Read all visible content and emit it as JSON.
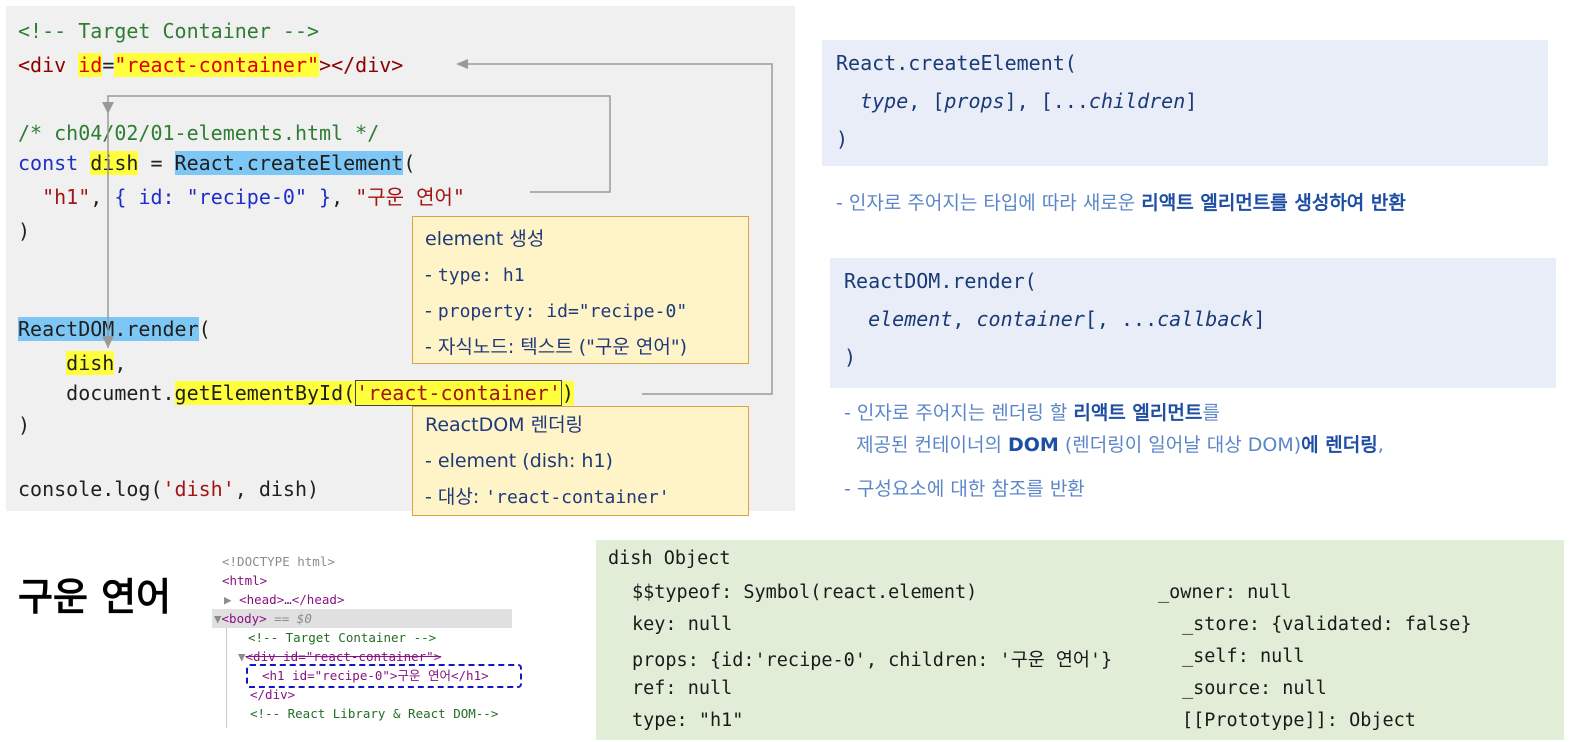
{
  "code": {
    "line1": "<!-- Target Container -->",
    "line2_open": "<div ",
    "line2_attr": "id",
    "line2_eq": "=",
    "line2_val": "\"react-container\"",
    "line2_close": "></div>",
    "line3": "/* ch04/02/01-elements.html */",
    "line4_const": "const ",
    "line4_var": "dish",
    "line4_eq": " = ",
    "line4_fn": "React.createElement",
    "line4_paren": "(",
    "line5_indent": "  ",
    "line5_type": "\"h1\"",
    "line5_comma": ", ",
    "line5_props": "{ id: \"recipe-0\" }",
    "line5_comma2": ", ",
    "line5_child": "\"구운 연어\"",
    "line6": ")",
    "line7_fn": "ReactDOM.render",
    "line7_paren": "(",
    "line8_indent": "    ",
    "line8_var": "dish",
    "line8_comma": ",",
    "line9_prefix": "    document.",
    "line9_fn": "getElementById(",
    "line9_arg": "'react-container'",
    "line9_close": ")",
    "line10": ")",
    "line11_prefix": "console.log(",
    "line11_str": "'dish'",
    "line11_suffix": ", dish)"
  },
  "note_element": {
    "title": "element 생성",
    "type_prefix": "- ",
    "type_value": "type: h1",
    "prop_prefix": "- ",
    "prop_value": "property: id=\"recipe-0\"",
    "child": "- 자식노드: 텍스트 (\"구운 연어\")"
  },
  "note_render": {
    "title": "ReactDOM 렌더링",
    "element": "- element (dish: h1)",
    "target_prefix": "- 대상: ",
    "target_value": "'react-container'"
  },
  "syntax_create": {
    "line1": "React.createElement(",
    "line2_indent": "  ",
    "line2_a": "type",
    "line2_b": ", [",
    "line2_c": "props",
    "line2_d": "], [...",
    "line2_e": "children",
    "line2_f": "]",
    "line3": ")"
  },
  "desc_create": {
    "prefix": "- 인자로 주어지는 타입에 따라 새로운 ",
    "bold": "리액트 엘리먼트를 생성하여 반환"
  },
  "syntax_render": {
    "line1": "ReactDOM.render(",
    "line2_indent": "  ",
    "line2_a": "element",
    "line2_b": ", ",
    "line2_c": "container",
    "line2_d": "[, ...",
    "line2_e": "callback",
    "line2_f": "]",
    "line3": ")"
  },
  "desc_render": {
    "l1_prefix": "- 인자로 주어지는 렌더링 할 ",
    "l1_bold": "리액트 엘리먼트",
    "l1_suffix": "를",
    "l2_prefix": "  제공된 컨테이너의 ",
    "l2_bold1": "DOM",
    "l2_mid": " (렌더링이 일어날 대상 DOM)",
    "l2_bold2": "에 렌더링",
    "l2_suffix": ",",
    "l3": "- 구성요소에 대한 참조를 반환"
  },
  "rendered_title": "구운 연어",
  "devtools": {
    "doctype": "<!DOCTYPE html>",
    "html": "<html>",
    "head_arrow": "▶",
    "head": "<head>…</head>",
    "body_arrow": "▼",
    "body_open": "<body>",
    "body_eq": " == $0",
    "comment1": "<!-- Target Container -->",
    "div_arrow": "▼",
    "div_open": "<div id=\"react-container\">",
    "h1": "<h1 id=\"recipe-0\">구운 연어</h1>",
    "div_close": "</div>",
    "comment2": "<!-- React Library & React DOM-->"
  },
  "dish_object": {
    "title": "dish Object",
    "left": [
      "$$typeof: Symbol(react.element)",
      "key: null",
      "props: {id:'recipe-0', children: '구운 연어'}",
      "ref: null",
      "type: \"h1\""
    ],
    "right": [
      "_owner: null",
      "_store: {validated: false}",
      "_self: null",
      "_source: null",
      "[[Prototype]]: Object"
    ]
  }
}
